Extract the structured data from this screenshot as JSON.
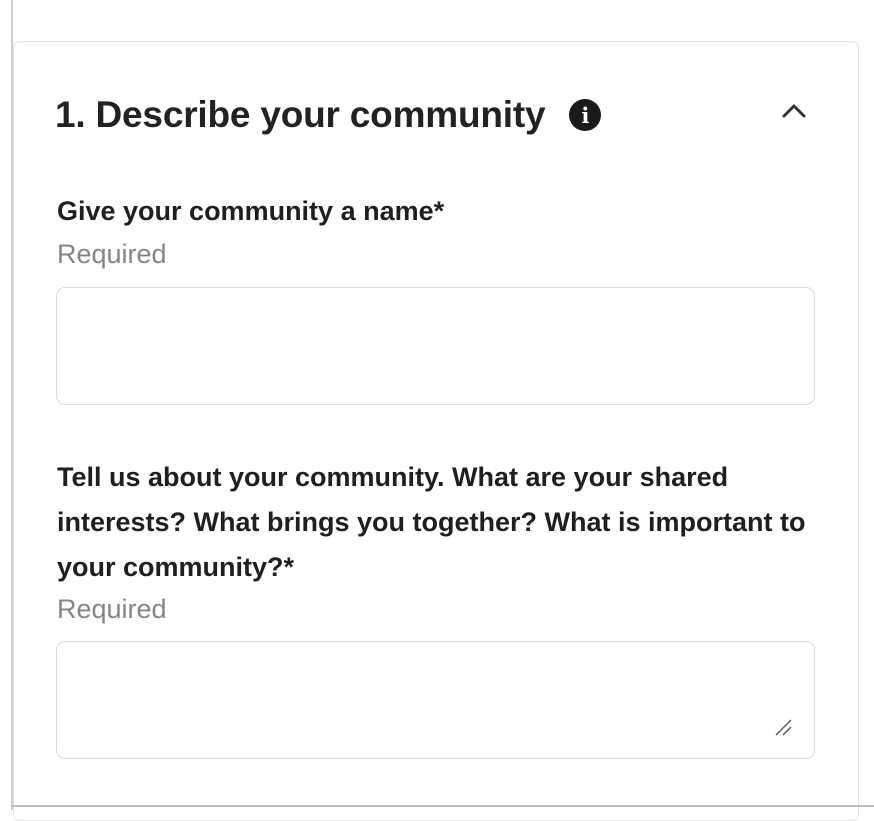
{
  "section": {
    "title": "1. Describe your community",
    "info_icon": "info-icon",
    "collapse_icon": "chevron-up-icon"
  },
  "fields": [
    {
      "label": "Give your community a name*",
      "helper": "Required",
      "value": ""
    },
    {
      "label": "Tell us about your community. What are your shared interests? What brings you together? What is important to your community?*",
      "helper": "Required",
      "value": ""
    }
  ]
}
